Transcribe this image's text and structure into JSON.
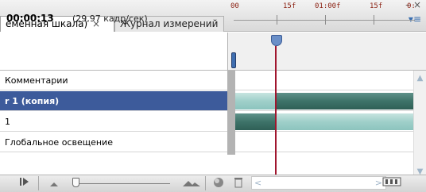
{
  "tabs": [
    {
      "label": "еменная шкала)",
      "close": "×"
    },
    {
      "label": "Журнал измерений"
    }
  ],
  "panel_menu": {
    "minimize": "–",
    "close": "×",
    "menu": "▾≡"
  },
  "header": {
    "timecode": "00:00:13",
    "fps": "(29,97 кадр/сек)"
  },
  "ruler": {
    "labels": [
      "00",
      "15f",
      "01:00f",
      "15f",
      "0:"
    ]
  },
  "layers": [
    {
      "name": "Комментарии",
      "selected": false
    },
    {
      "name": "r 1 (копия)",
      "selected": true
    },
    {
      "name": "1",
      "selected": false
    },
    {
      "name": "Глобальное освещение",
      "selected": false
    }
  ],
  "tracks": [
    {
      "light": 0,
      "dark": 0
    },
    {
      "light": 0.23,
      "dark": 0.77
    },
    {
      "light": 0.77,
      "dark": 0.23
    },
    {
      "light": 0,
      "dark": 0
    }
  ],
  "icons": {
    "play": "play-icon",
    "zoom_out": "zoom-out-mountain-icon",
    "zoom_in": "zoom-in-mountain-icon",
    "onion": "onion-skin-icon",
    "trash": "trash-icon",
    "scroll_left": "scroll-left-icon",
    "scroll_right": "scroll-right-icon",
    "frames": "frames-icon"
  },
  "colors": {
    "selected_row": "#3d5b9b",
    "playhead": "#a0162e",
    "tick_label": "#8a1f10"
  }
}
